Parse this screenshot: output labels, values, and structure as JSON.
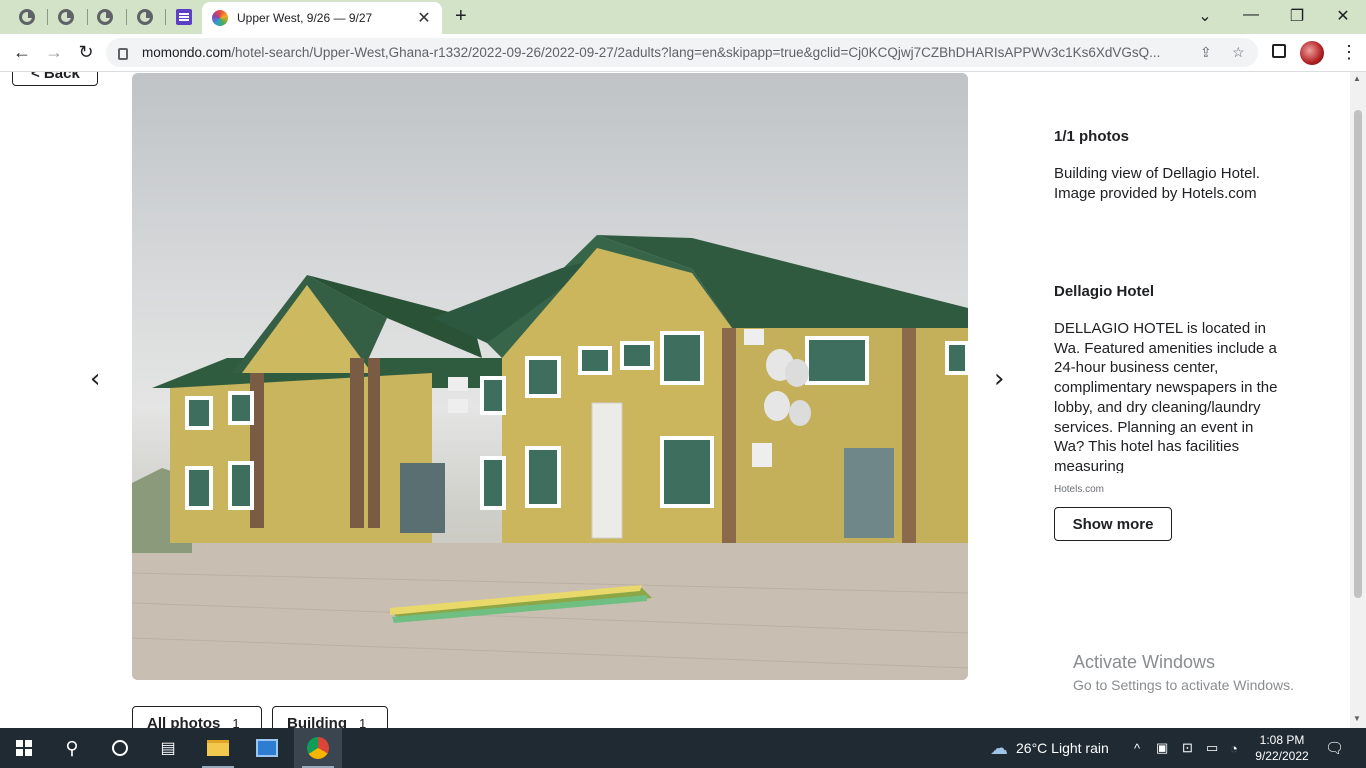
{
  "browser": {
    "active_tab_title": "Upper West, 9/26 — 9/27",
    "url_host": "momondo.com",
    "url_path": "/hotel-search/Upper-West,Ghana-r1332/2022-09-26/2022-09-27/2adults?lang=en&skipapp=true&gclid=Cj0KCQjwj7CZBhDHARIsAPPWv3c1Ks6XdVGsQ..."
  },
  "page": {
    "back_label": "< Back",
    "photo_count": "1/1 photos",
    "caption": "Building view of Dellagio Hotel. Image provided by Hotels.com",
    "hotel_name": "Dellagio Hotel",
    "description": "DELLAGIO HOTEL is located in Wa. Featured amenities include a 24-hour business center, complimentary newspapers in the lobby, and dry cleaning/laundry services. Planning an event in Wa? This hotel has facilities measuring",
    "source": "Hotels.com",
    "show_more": "Show more",
    "chips": [
      {
        "label": "All photos",
        "count": "1"
      },
      {
        "label": "Building",
        "count": "1"
      }
    ]
  },
  "watermark": {
    "line1": "Activate Windows",
    "line2": "Go to Settings to activate Windows."
  },
  "taskbar": {
    "weather": "26°C  Light rain",
    "time": "1:08 PM",
    "date": "9/22/2022"
  }
}
